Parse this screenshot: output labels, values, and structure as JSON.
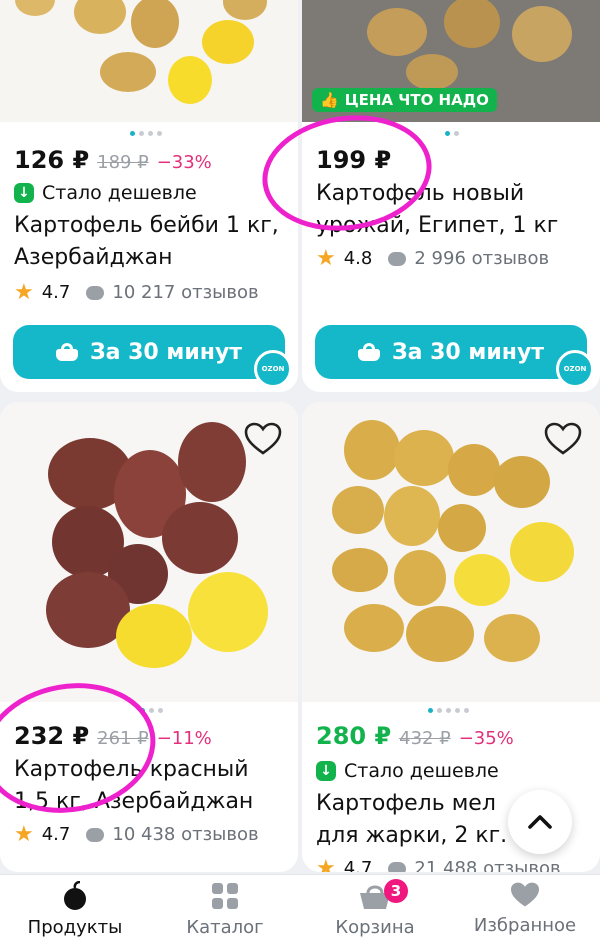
{
  "products": [
    {
      "price": "126 ₽",
      "old_price": "189 ₽",
      "discount": "−33%",
      "badge": "Стало дешевле",
      "title": "Картофель бейби 1 кг, Азербайджан",
      "rating": "4.7",
      "reviews": "10 217 отзывов",
      "cta": "За 30 минут"
    },
    {
      "promo": "ЦЕНА ЧТО НАДО",
      "price": "199 ₽",
      "title": "Картофель новый урожай, Египет, 1 кг",
      "rating": "4.8",
      "reviews": "2 996 отзывов",
      "cta": "За 30 минут"
    },
    {
      "price": "232 ₽",
      "old_price": "261 ₽",
      "discount": "−11%",
      "title": "Картофель красный 1,5 кг, Азербайджан",
      "rating": "4.7",
      "reviews": "10 438 отзывов"
    },
    {
      "price": "280 ₽",
      "old_price": "432 ₽",
      "discount": "−35%",
      "badge": "Стало дешевле",
      "title": "Картофель мел для жарки, 2 кг.",
      "rating": "4.7",
      "reviews": "21 488 отзывов"
    }
  ],
  "ozon_label": "OZON",
  "nav": {
    "products": "Продукты",
    "catalog": "Каталог",
    "cart": "Корзина",
    "cart_count": "3",
    "favorites": "Избранное"
  },
  "colors": {
    "accent": "#15b8c8",
    "discount": "#e2307a",
    "green": "#12b24c",
    "highlight": "#ee22cc"
  },
  "icons": [
    "cheaper-check-icon",
    "star-icon",
    "review-bubble-icon",
    "basket-icon",
    "heart-icon",
    "scroll-up-icon",
    "products-icon",
    "catalog-icon",
    "cart-icon",
    "favorites-icon"
  ]
}
